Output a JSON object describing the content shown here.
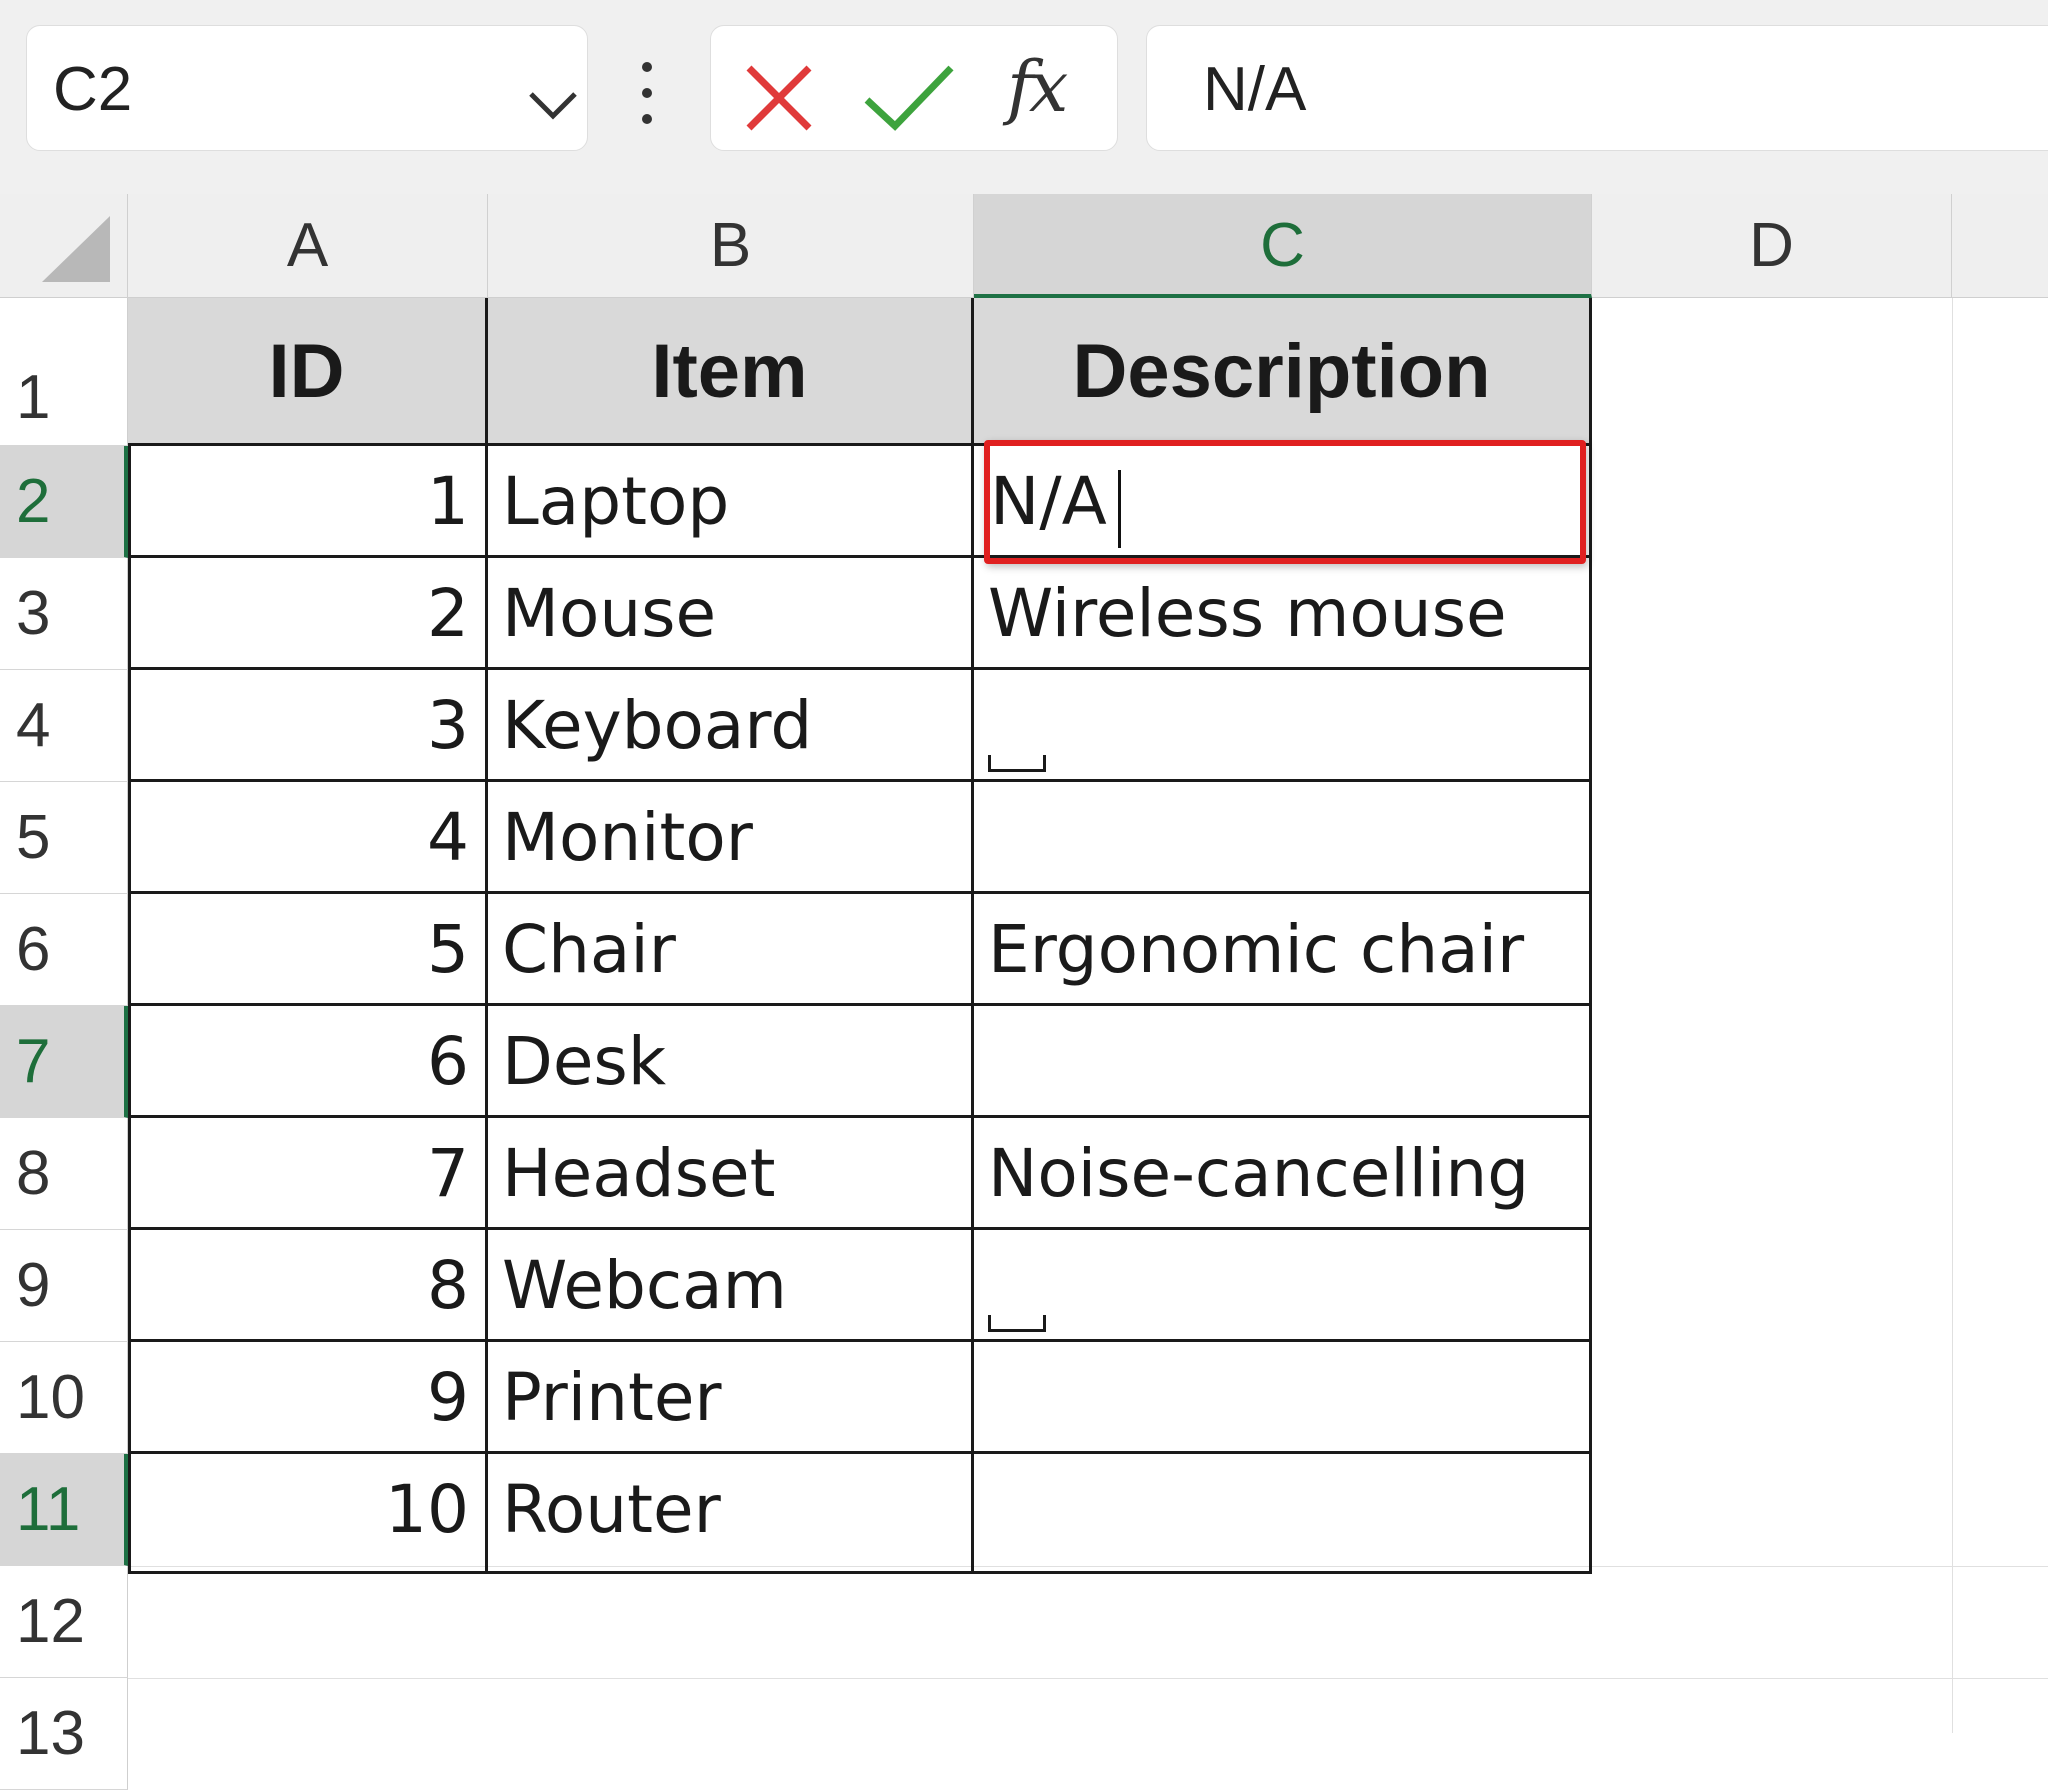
{
  "formula_bar": {
    "name_box": "C2",
    "formula": "N/A",
    "fx_label": "fx"
  },
  "columns": [
    "A",
    "B",
    "C",
    "D"
  ],
  "rows": [
    "1",
    "2",
    "3",
    "4",
    "5",
    "6",
    "7",
    "8",
    "9",
    "10",
    "11",
    "12",
    "13"
  ],
  "header": {
    "id": "ID",
    "item": "Item",
    "description": "Description"
  },
  "table": [
    {
      "id": "1",
      "item": "Laptop",
      "description": "N/A"
    },
    {
      "id": "2",
      "item": "Mouse",
      "description": "Wireless mouse"
    },
    {
      "id": "3",
      "item": "Keyboard",
      "description": ""
    },
    {
      "id": "4",
      "item": "Monitor",
      "description": ""
    },
    {
      "id": "5",
      "item": "Chair",
      "description": "Ergonomic chair"
    },
    {
      "id": "6",
      "item": "Desk",
      "description": ""
    },
    {
      "id": "7",
      "item": "Headset",
      "description": "Noise-cancelling"
    },
    {
      "id": "8",
      "item": "Webcam",
      "description": ""
    },
    {
      "id": "9",
      "item": "Printer",
      "description": ""
    },
    {
      "id": "10",
      "item": "Router",
      "description": ""
    }
  ],
  "colors": {
    "selection_outline": "#e02020",
    "active_header_text": "#1e6e3a",
    "header_fill": "#d9d9d9",
    "gray_cell_fill": "#c6c6c6"
  }
}
